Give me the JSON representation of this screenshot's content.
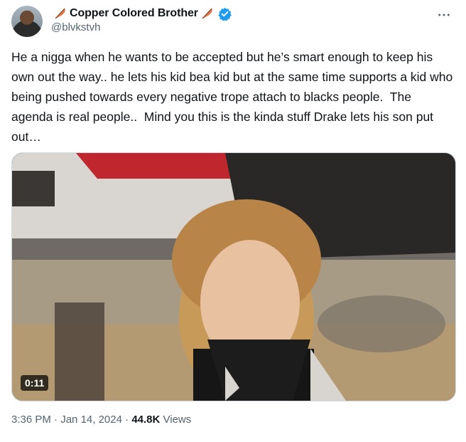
{
  "author": {
    "name": "Copper Colored Brother",
    "handle": "@blvkstvh",
    "verified": true
  },
  "tweet": {
    "text": "He a nigga when he wants to be accepted but he’s smart enough to keep his own out the way.. he lets his kid bea kid but at the same time supports a kid who being pushed towards every negative trope attach to blacks people.  The agenda is real people..  Mind you this is the kinda stuff Drake lets his son put out…"
  },
  "media": {
    "type": "video",
    "duration": "0:11"
  },
  "meta": {
    "time": "3:36 PM",
    "separator": "·",
    "date": "Jan 14, 2024",
    "views_count": "44.8K",
    "views_label": "Views"
  },
  "icons": {
    "more": "more-icon",
    "verified": "verified-badge-icon",
    "feather": "feather-emoji-icon"
  },
  "colors": {
    "verified_blue": "#1d9bf0",
    "secondary_text": "#536471",
    "primary_text": "#0f1419"
  }
}
